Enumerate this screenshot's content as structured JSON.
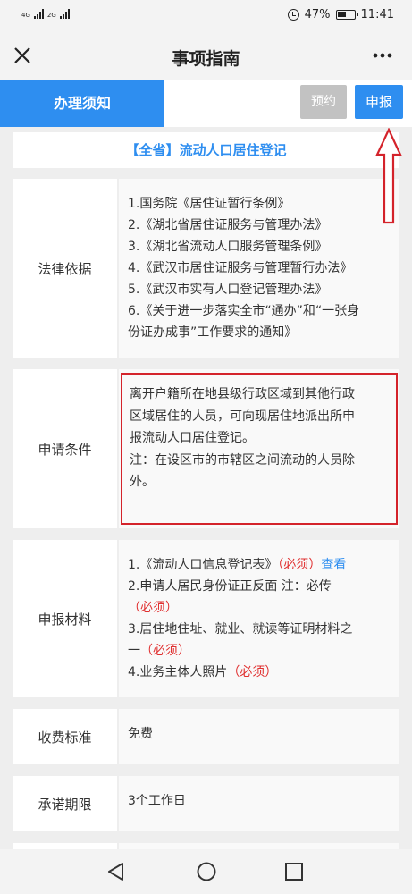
{
  "status_bar": {
    "signal1_label": "4G",
    "signal2_label": "2G",
    "battery": "47%",
    "time": "11:41"
  },
  "nav": {
    "title": "事项指南"
  },
  "actions": {
    "tab_notice": "办理须知",
    "reserve": "预约",
    "apply": "申报"
  },
  "heading": "【全省】流动人口居住登记",
  "legal": {
    "label": "法律依据",
    "items": [
      "1.国务院《居住证暂行条例》",
      "2.《湖北省居住证服务与管理办法》",
      "3.《湖北省流动人口服务管理条例》",
      "4.《武汉市居住证服务与管理暂行办法》",
      "5.《武汉市实有人口登记管理办法》",
      "6.《关于进一步落实全市“通办”和“一张身",
      "份证办成事”工作要求的通知》"
    ]
  },
  "conditions": {
    "label": "申请条件",
    "lines": [
      "离开户籍所在地县级行政区域到其他行政",
      "区域居住的人员，可向现居住地派出所申",
      "报流动人口居住登记。",
      " 注：在设区市的市辖区之间流动的人员除",
      "外。"
    ]
  },
  "materials": {
    "label": "申报材料",
    "item1": "1.《流动人口信息登记表》",
    "item2": "2.申请人居民身份证正反面 注：必传",
    "item3": "3.居住地住址、就业、就读等证明材料之",
    "item3_cont": "一",
    "item4": "4.业务主体人照片",
    "required": "（必须）",
    "view": "查看"
  },
  "fee": {
    "label": "收费标准",
    "value": "免费"
  },
  "deadline": {
    "label": "承诺期限",
    "value": "3个工作日"
  },
  "colors": {
    "primary": "#2e8ef0",
    "required": "#e03030",
    "annotation": "#d4232b"
  }
}
